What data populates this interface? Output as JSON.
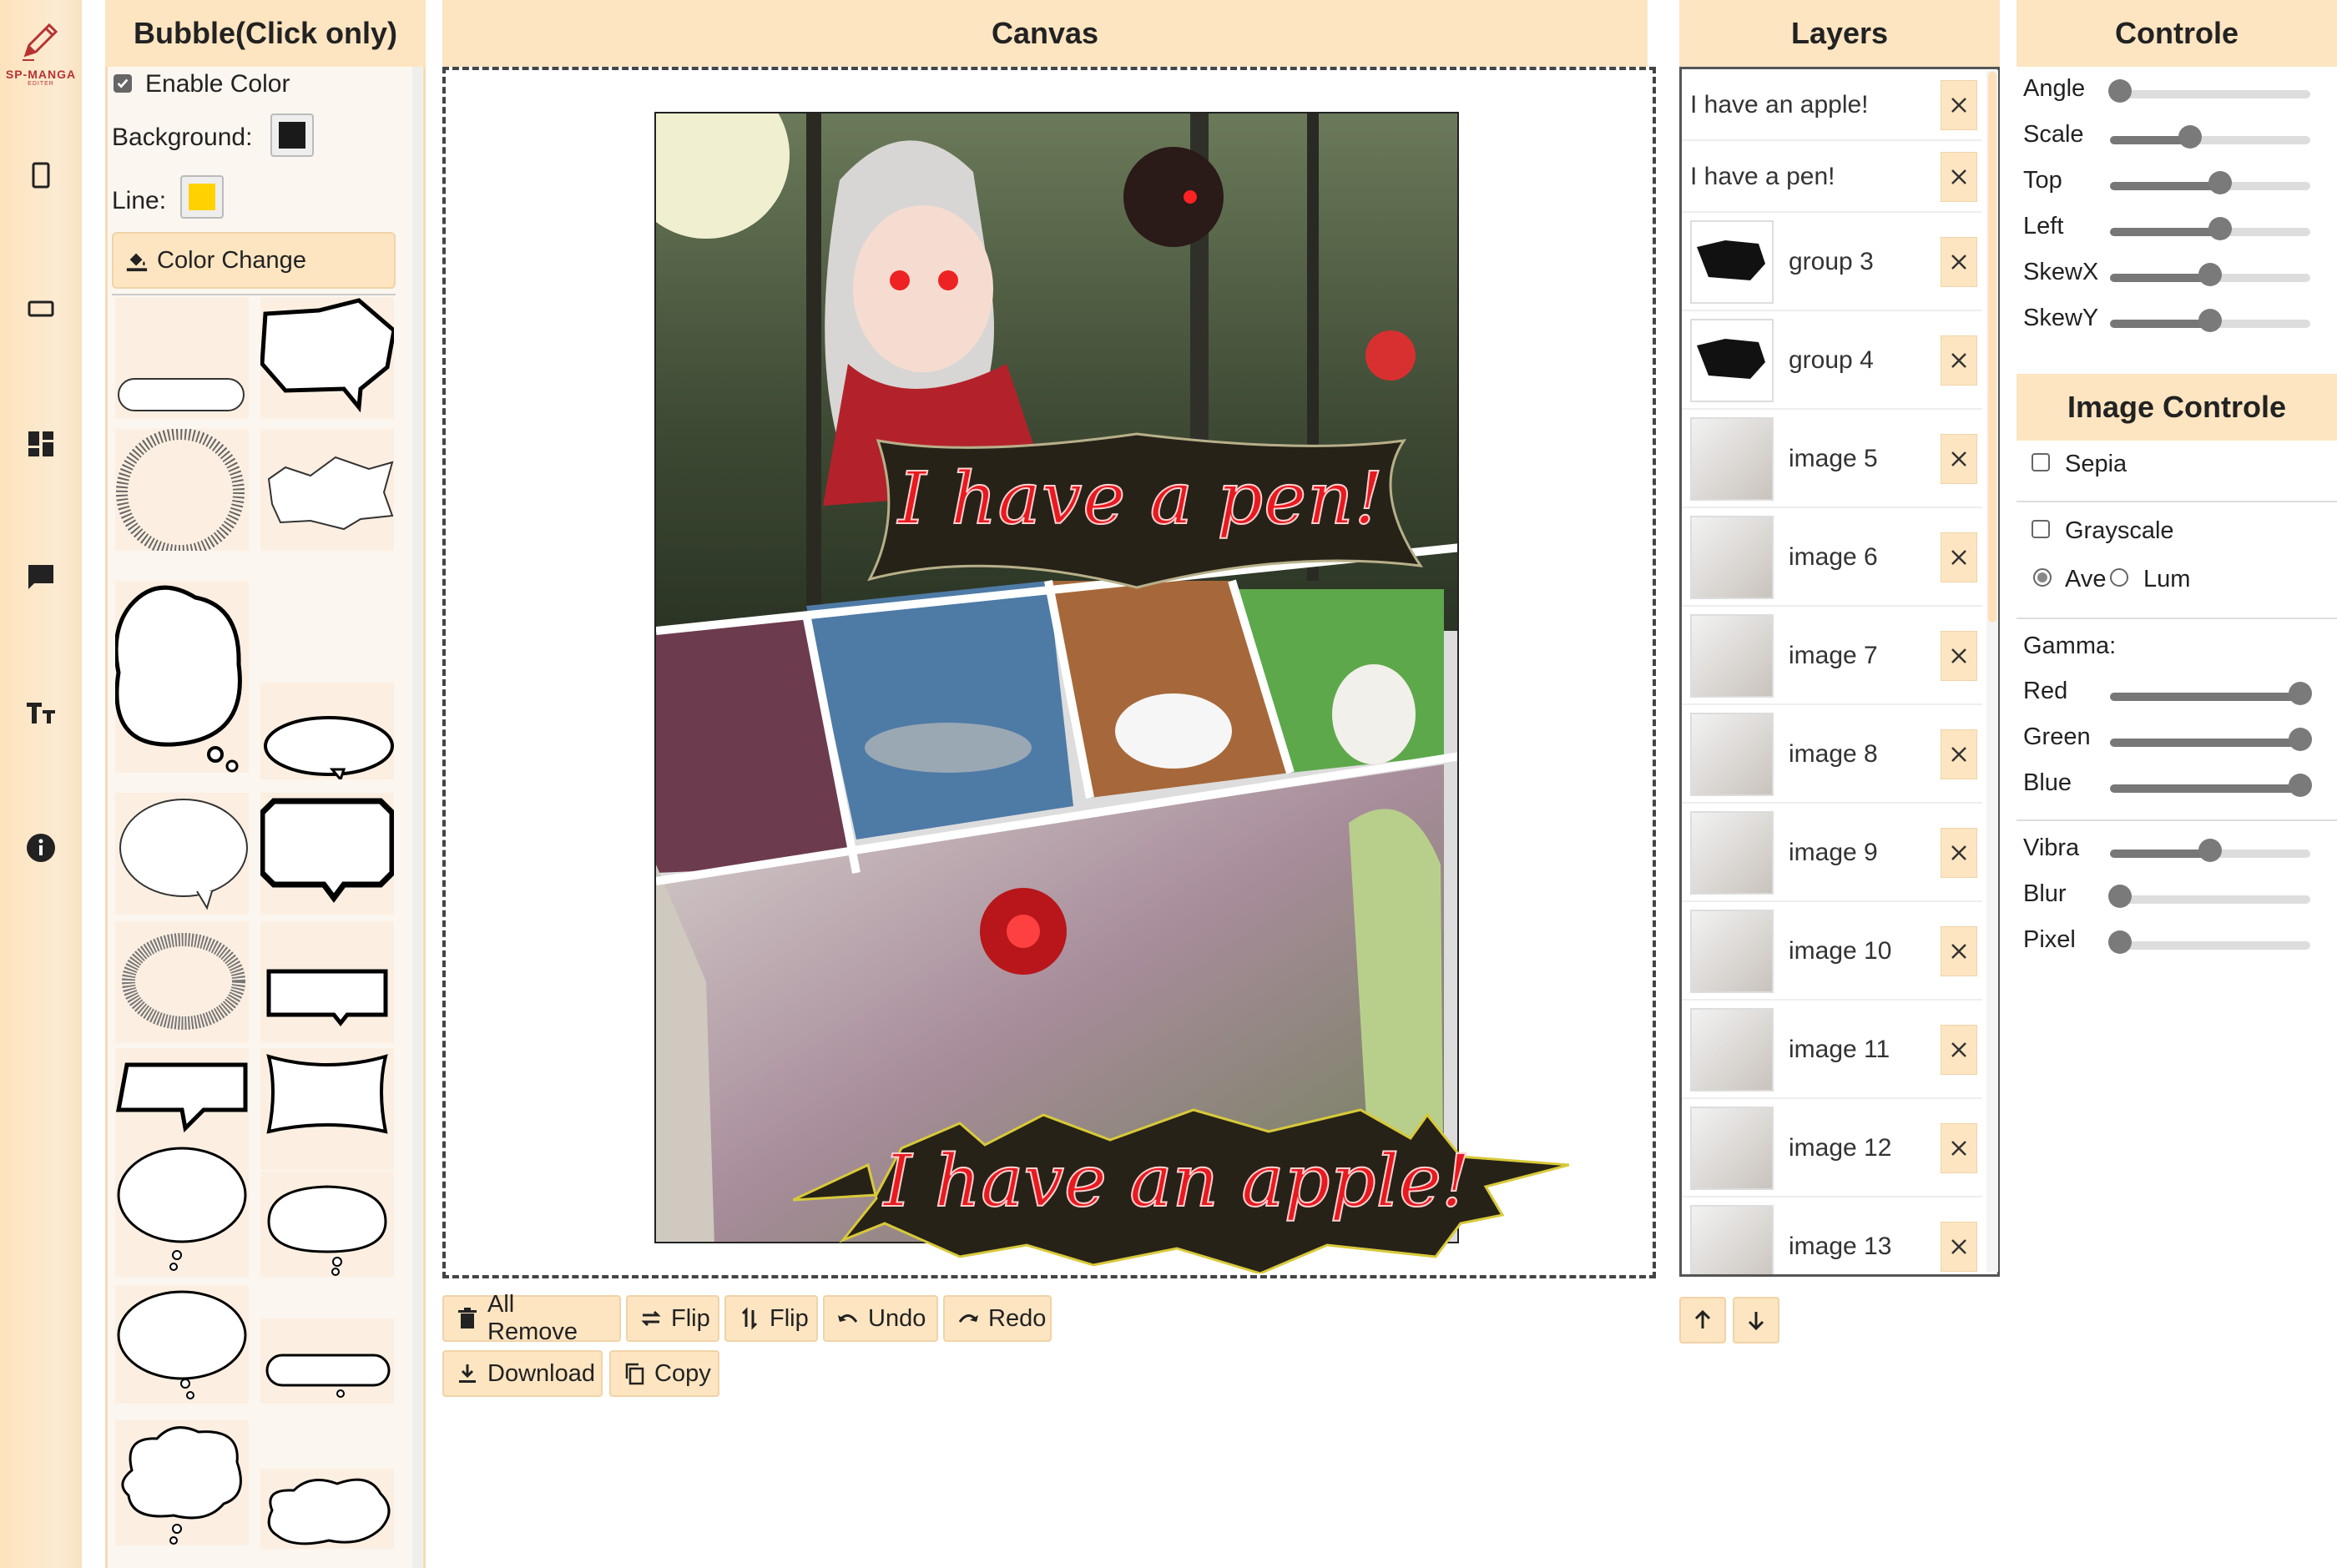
{
  "app": {
    "logo_text": "SP-MANGA",
    "logo_sub": "EDITER"
  },
  "rail": {
    "icons": [
      "portrait-page-icon",
      "landscape-page-icon",
      "dashboard-icon",
      "chat-bubble-icon",
      "text-size-icon",
      "info-icon"
    ]
  },
  "bubble_panel": {
    "title": "Bubble(Click only)",
    "enable_color_label": "Enable Color",
    "enable_color_checked": true,
    "background_label": "Background:",
    "background_color": "#1a1a1a",
    "line_label": "Line:",
    "line_color": "#ffd200",
    "color_change_label": "Color Change"
  },
  "canvas_panel": {
    "title": "Canvas",
    "bubble_top_text": "I have a pen!",
    "bubble_bottom_text": "I have an apple!",
    "toolbar": {
      "all_remove": "All Remove",
      "flip_h": "Flip",
      "flip_v": "Flip",
      "undo": "Undo",
      "redo": "Redo",
      "download": "Download",
      "copy": "Copy"
    }
  },
  "layers_panel": {
    "title": "Layers",
    "items": [
      {
        "name": "I have an apple!",
        "kind": "text"
      },
      {
        "name": "I have a pen!",
        "kind": "text"
      },
      {
        "name": "group 3",
        "kind": "group"
      },
      {
        "name": "group 4",
        "kind": "group"
      },
      {
        "name": "image 5",
        "kind": "image"
      },
      {
        "name": "image 6",
        "kind": "image"
      },
      {
        "name": "image 7",
        "kind": "image"
      },
      {
        "name": "image 8",
        "kind": "image"
      },
      {
        "name": "image 9",
        "kind": "image"
      },
      {
        "name": "image 10",
        "kind": "image"
      },
      {
        "name": "image 11",
        "kind": "image"
      },
      {
        "name": "image 12",
        "kind": "image"
      },
      {
        "name": "image 13",
        "kind": "image"
      }
    ]
  },
  "control_panel": {
    "title": "Controle",
    "sliders": [
      {
        "label": "Angle",
        "value": 0.05
      },
      {
        "label": "Scale",
        "value": 0.4
      },
      {
        "label": "Top",
        "value": 0.55
      },
      {
        "label": "Left",
        "value": 0.55
      },
      {
        "label": "SkewX",
        "value": 0.5
      },
      {
        "label": "SkewY",
        "value": 0.5
      }
    ]
  },
  "image_control_panel": {
    "title": "Image Controle",
    "sepia_label": "Sepia",
    "grayscale_label": "Grayscale",
    "ave_label": "Ave",
    "lum_label": "Lum",
    "gamma_label": "Gamma:",
    "gamma_sliders": [
      {
        "label": "Red",
        "value": 0.95
      },
      {
        "label": "Green",
        "value": 0.95
      },
      {
        "label": "Blue",
        "value": 0.95
      }
    ],
    "effect_sliders": [
      {
        "label": "Vibra",
        "value": 0.5
      },
      {
        "label": "Blur",
        "value": 0.05
      },
      {
        "label": "Pixel",
        "value": 0.05
      }
    ]
  },
  "colors": {
    "accent": "#fde5c1",
    "panel_bg": "#fbf6ef",
    "text_red": "#e8191f"
  }
}
